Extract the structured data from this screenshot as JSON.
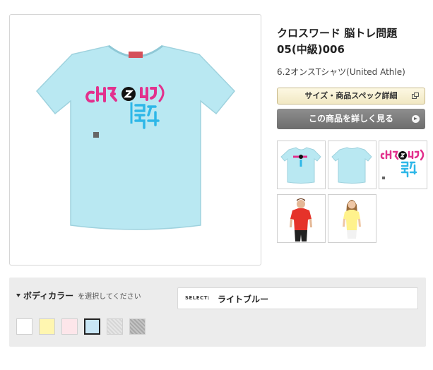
{
  "product": {
    "title": "クロスワード 脳トレ問題05(中級)006",
    "subtitle": "6.2オンスTシャツ(United Athle)"
  },
  "buttons": {
    "spec_label": "サイズ・商品スペック詳細",
    "detail_label": "この商品を詳しく見る"
  },
  "design": {
    "top_text": "CLI",
    "bottom_text": "到是"
  },
  "colors": {
    "shirt": "#b9e8f2",
    "magenta": "#e2318d",
    "cyan": "#2eb7e8",
    "button_dark": "#7b7b7b",
    "button_cream": "#f6efd3"
  },
  "color_selector": {
    "heading": "ボディカラー",
    "subheading": "を選択してください",
    "select_label": "SELECT:",
    "selected_value": "ライトブルー",
    "swatches": [
      {
        "name": "white",
        "color": "#ffffff"
      },
      {
        "name": "light-yellow",
        "color": "#fff6b0"
      },
      {
        "name": "light-pink",
        "color": "#fde6ea"
      },
      {
        "name": "light-blue",
        "color": "#c9e7f6",
        "selected": true
      },
      {
        "name": "ash",
        "color": "#e2e2e2"
      },
      {
        "name": "heather-gray",
        "color": "#bdbdbd"
      }
    ]
  }
}
